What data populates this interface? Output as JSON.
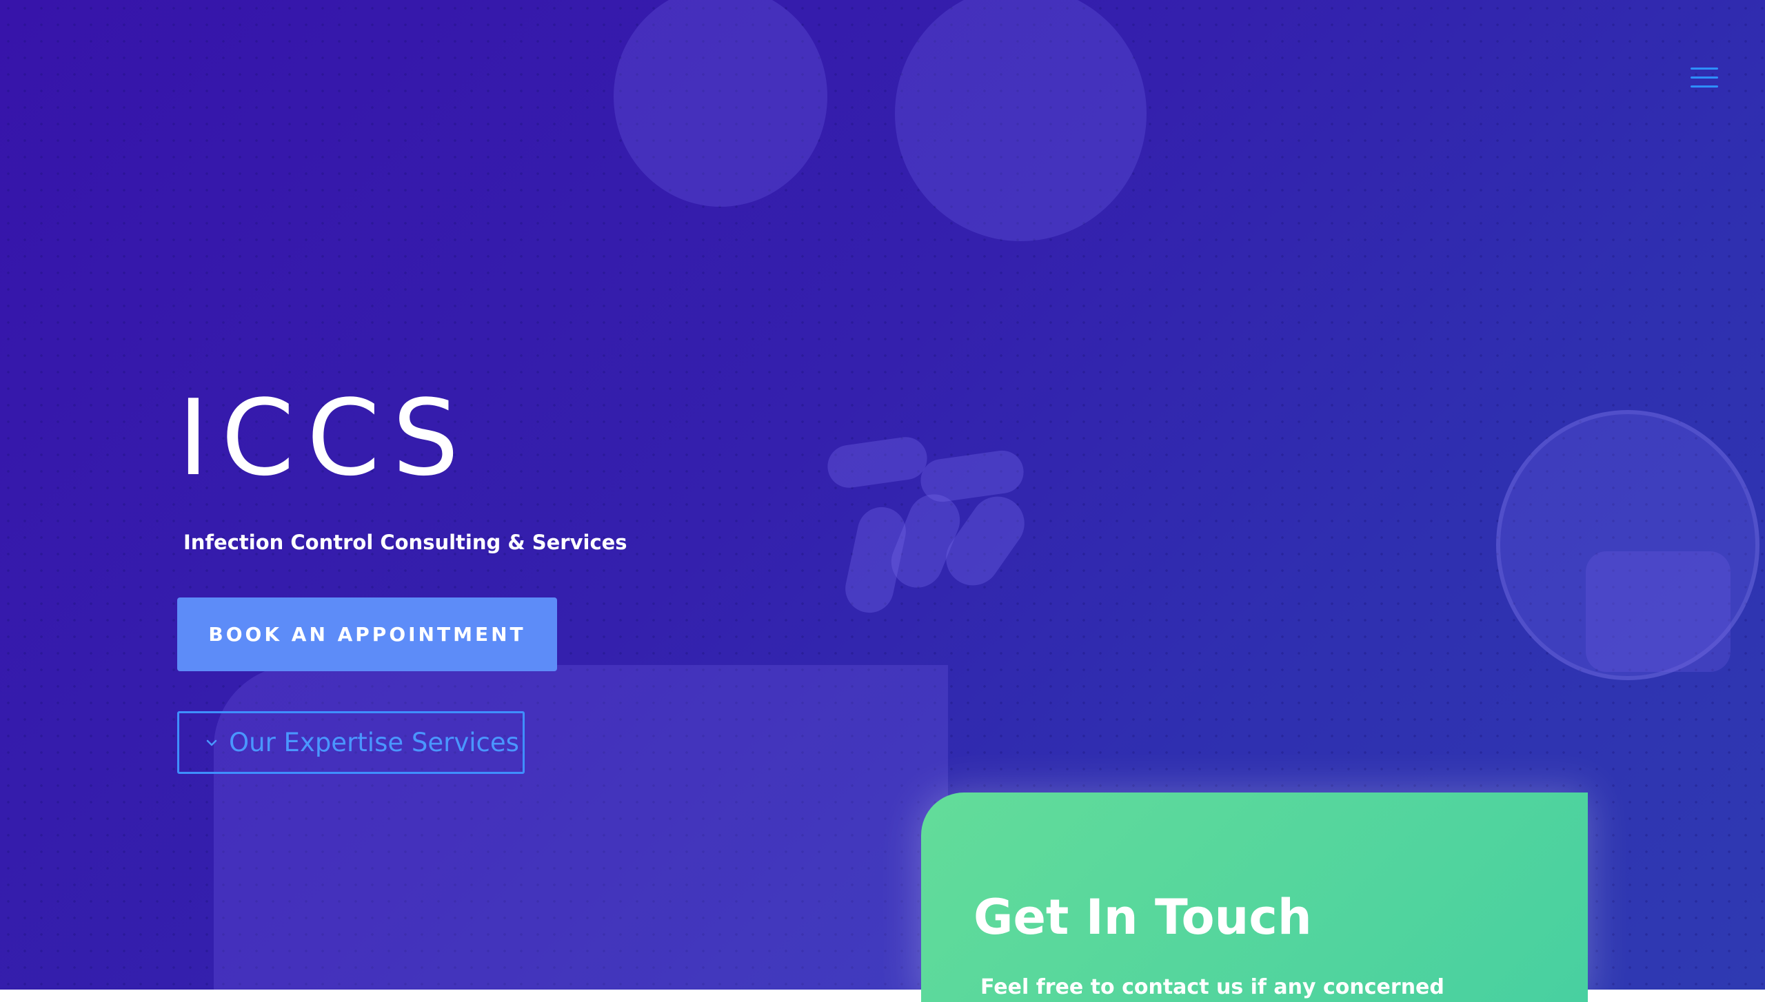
{
  "header": {
    "menu_icon": "hamburger-menu-icon"
  },
  "hero": {
    "title": "ICCS",
    "subtitle": "Infection Control Consulting & Services",
    "book_button_label": "BOOK AN APPOINTMENT",
    "expertise_button_label": "Our Expertise Services",
    "expertise_button_icon": "chevron-down-icon"
  },
  "contact_card": {
    "title": "Get In Touch",
    "text": "Feel free to contact us if any concerned"
  },
  "colors": {
    "background": "#3518ab",
    "button_primary": "#5d8cf8",
    "outline_accent": "#3f8fff",
    "card_green": "#55d79d",
    "text": "#ffffff"
  }
}
